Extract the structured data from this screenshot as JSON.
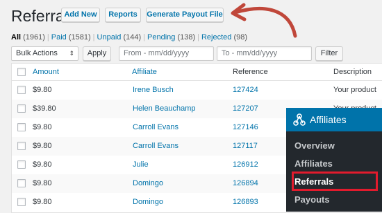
{
  "header": {
    "title": "Referrals",
    "buttons": [
      "Add New",
      "Reports",
      "Generate Payout File"
    ]
  },
  "filters": {
    "items": [
      {
        "label": "All",
        "count": "(1961)"
      },
      {
        "label": "Paid",
        "count": "(1581)"
      },
      {
        "label": "Unpaid",
        "count": "(144)"
      },
      {
        "label": "Pending",
        "count": "(138)"
      },
      {
        "label": "Rejected",
        "count": "(98)"
      }
    ],
    "separator": "|"
  },
  "toolbar": {
    "bulk_actions": "Bulk Actions",
    "apply_label": "Apply",
    "from_placeholder": "From - mm/dd/yyyy",
    "to_placeholder": "To - mm/dd/yyyy",
    "filter_label": "Filter"
  },
  "table": {
    "columns": [
      "Amount",
      "Affiliate",
      "Reference",
      "Description"
    ],
    "rows": [
      {
        "amount": "$9.80",
        "affiliate": "Irene Busch",
        "reference": "127424",
        "description": "Your product"
      },
      {
        "amount": "$39.80",
        "affiliate": "Helen Beauchamp",
        "reference": "127207",
        "description": "Your product"
      },
      {
        "amount": "$9.80",
        "affiliate": "Carroll Evans",
        "reference": "127146",
        "description": ""
      },
      {
        "amount": "$9.80",
        "affiliate": "Carroll Evans",
        "reference": "127117",
        "description": ""
      },
      {
        "amount": "$9.80",
        "affiliate": "Julie",
        "reference": "126912",
        "description": ""
      },
      {
        "amount": "$9.80",
        "affiliate": "Domingo",
        "reference": "126894",
        "description": ""
      },
      {
        "amount": "$9.80",
        "affiliate": "Domingo",
        "reference": "126893",
        "description": ""
      }
    ]
  },
  "menu": {
    "title": "Affiliates",
    "items": [
      "Overview",
      "Affiliates",
      "Referrals",
      "Payouts"
    ],
    "current": "Referrals"
  },
  "colors": {
    "link": "#0073aa",
    "menu_bg": "#23282d",
    "menu_head": "#0073aa",
    "highlight": "#e21b2d",
    "annotation_arrow": "#c0473a"
  }
}
